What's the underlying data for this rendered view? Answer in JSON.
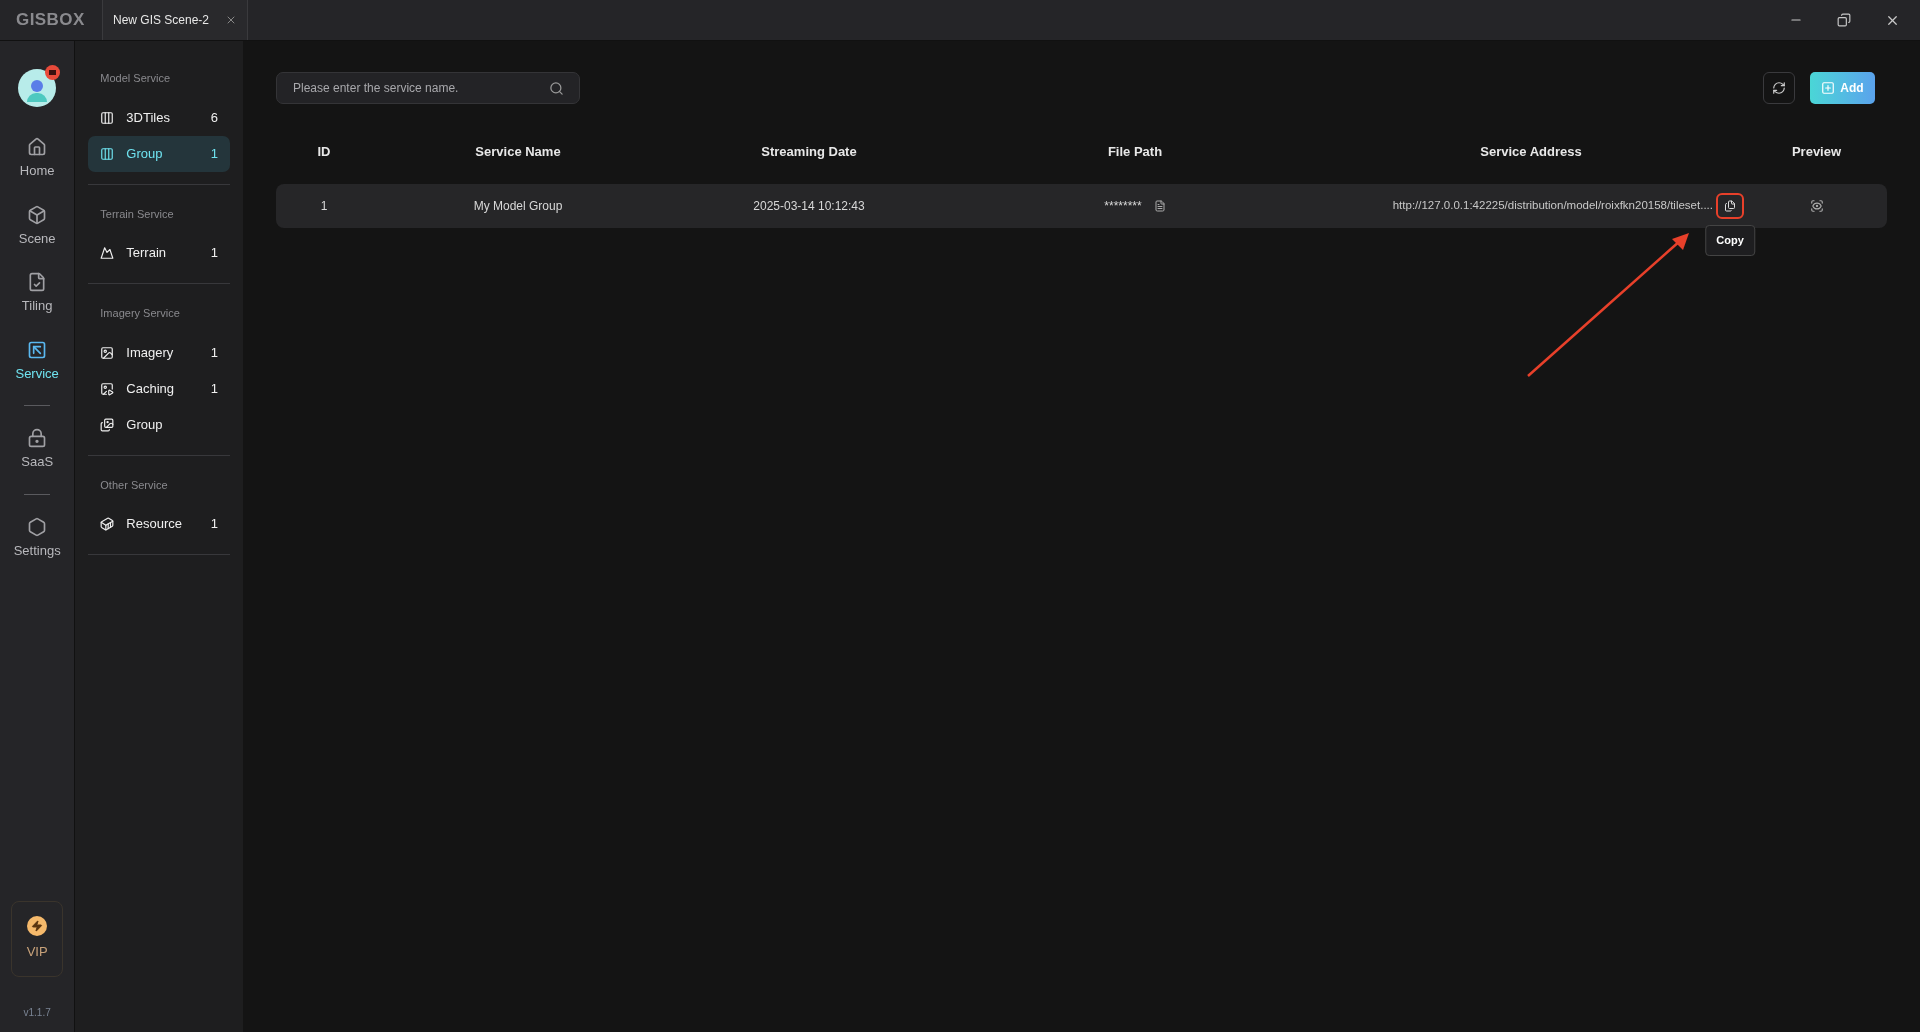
{
  "titlebar": {
    "logo": "GISBOX",
    "tabs": [
      {
        "label": "New GIS Scene-2",
        "selected": true
      }
    ]
  },
  "nav": {
    "groups": [
      [
        {
          "label": "Home",
          "selected": false
        },
        {
          "label": "Scene",
          "selected": false
        },
        {
          "label": "Tiling",
          "selected": false
        },
        {
          "label": "Service",
          "selected": true
        }
      ],
      [
        {
          "label": "SaaS",
          "selected": false
        }
      ],
      [
        {
          "label": "Settings",
          "selected": false
        }
      ]
    ],
    "vip": "VIP",
    "version": "v1.1.7"
  },
  "sidebar": {
    "sections": [
      {
        "title": "Model Service",
        "items": [
          {
            "label": "3DTiles",
            "count": "6",
            "selected": false
          },
          {
            "label": "Group",
            "count": "1",
            "selected": true
          }
        ]
      },
      {
        "title": "Terrain Service",
        "items": [
          {
            "label": "Terrain",
            "count": "1",
            "selected": false
          }
        ]
      },
      {
        "title": "Imagery Service",
        "items": [
          {
            "label": "Imagery",
            "count": "1",
            "selected": false
          },
          {
            "label": "Caching",
            "count": "1",
            "selected": false
          },
          {
            "label": "Group",
            "selected": false
          }
        ]
      },
      {
        "title": "Other Service",
        "items": [
          {
            "label": "Resource",
            "count": "1",
            "selected": false
          }
        ]
      }
    ]
  },
  "search": {
    "placeholder": "Please enter the service name."
  },
  "add_button": "Add",
  "table": {
    "columns": [
      "ID",
      "Service Name",
      "Streaming Date",
      "File Path",
      "Service Address",
      "Preview"
    ],
    "rows": [
      {
        "id": "1",
        "name": "My Model Group",
        "date": "2025-03-14 10:12:43",
        "path": "********",
        "address": "http://127.0.0.1:42225/distribution/model/roixfkn20158/tileset...."
      }
    ]
  },
  "tooltip": "Copy"
}
